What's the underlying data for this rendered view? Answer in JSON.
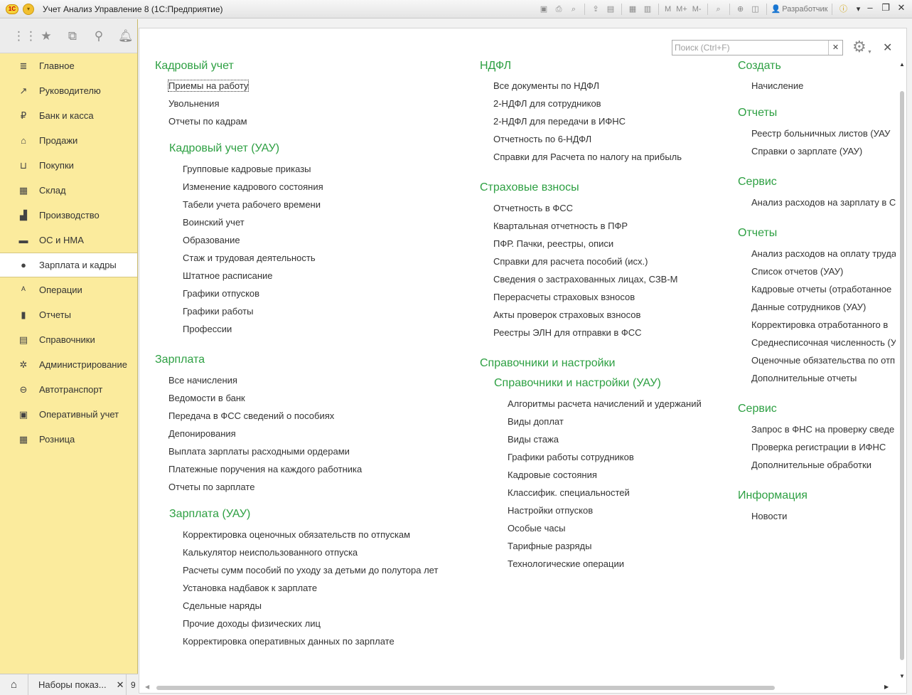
{
  "window": {
    "logo": "1С",
    "title": "Учет Анализ Управление 8  (1С:Предприятие)",
    "toolbar_text": [
      "M",
      "M+",
      "M-"
    ],
    "user": "Разработчик"
  },
  "quickbar": [
    "apps-grid-icon",
    "favorites-star-icon",
    "history-icon",
    "search-icon",
    "bell-icon"
  ],
  "sidebar": {
    "items": [
      {
        "label": "Главное",
        "icon": "≣"
      },
      {
        "label": "Руководителю",
        "icon": "↗"
      },
      {
        "label": "Банк и касса",
        "icon": "₽"
      },
      {
        "label": "Продажи",
        "icon": "⌂"
      },
      {
        "label": "Покупки",
        "icon": "⊔"
      },
      {
        "label": "Склад",
        "icon": "▦"
      },
      {
        "label": "Производство",
        "icon": "▟"
      },
      {
        "label": "ОС и НМА",
        "icon": "▬"
      },
      {
        "label": "Зарплата и кадры",
        "icon": "●"
      },
      {
        "label": "Операции",
        "icon": "ᴬ"
      },
      {
        "label": "Отчеты",
        "icon": "▮"
      },
      {
        "label": "Справочники",
        "icon": "▤"
      },
      {
        "label": "Администрирование",
        "icon": "✲"
      },
      {
        "label": "Автотранспорт",
        "icon": "⊖"
      },
      {
        "label": "Оперативный учет",
        "icon": "▣"
      },
      {
        "label": "Розница",
        "icon": "▦"
      }
    ],
    "active_index": 8
  },
  "bottom": {
    "tab_label": "Наборы показ...",
    "more": "9"
  },
  "search": {
    "placeholder": "Поиск (Ctrl+F)",
    "value": ""
  },
  "col1": {
    "kadry_head": "Кадровый учет",
    "kadry": [
      "Приемы на работу",
      "Увольнения",
      "Отчеты по кадрам"
    ],
    "kadry_uau_head": "Кадровый учет (УАУ)",
    "kadry_uau": [
      "Групповые кадровые приказы",
      "Изменение кадрового состояния",
      "Табели учета рабочего времени",
      "Воинский учет",
      "Образование",
      "Стаж и трудовая деятельность",
      "Штатное расписание",
      "Графики отпусков",
      "Графики работы",
      "Профессии"
    ],
    "zp_head": "Зарплата",
    "zp": [
      "Все начисления",
      "Ведомости в банк",
      "Передача в ФСС сведений о пособиях",
      "Депонирования",
      "Выплата зарплаты расходными ордерами",
      "Платежные поручения на каждого работника",
      "Отчеты по зарплате"
    ],
    "zp_uau_head": "Зарплата (УАУ)",
    "zp_uau": [
      "Корректировка оценочных обязательств по отпускам",
      "Калькулятор неиспользованного отпуска",
      "Расчеты сумм пособий по уходу за детьми до полутора лет",
      "Установка надбавок к зарплате",
      "Сдельные наряды",
      "Прочие доходы физических лиц",
      "Корректировка оперативных данных по зарплате"
    ]
  },
  "col2": {
    "ndfl_head": "НДФЛ",
    "ndfl": [
      "Все документы по НДФЛ",
      "2-НДФЛ для сотрудников",
      "2-НДФЛ для передачи в ИФНС",
      "Отчетность по 6-НДФЛ",
      "Справки для Расчета по налогу на прибыль"
    ],
    "vznosy_head": "Страховые взносы",
    "vznosy": [
      "Отчетность в ФСС",
      "Квартальная отчетность в ПФР",
      "ПФР. Пачки, реестры, описи",
      "Справки для расчета пособий (исх.)",
      "Сведения о застрахованных лицах, СЗВ-М",
      "Перерасчеты страховых взносов",
      "Акты проверок страховых взносов",
      "Реестры ЭЛН для отправки в ФСС"
    ],
    "sprav_head": "Справочники и настройки",
    "sprav_uau_head": "Справочники и настройки (УАУ)",
    "sprav_uau": [
      "Алгоритмы расчета начислений и удержаний",
      "Виды доплат",
      "Виды стажа",
      "Графики работы сотрудников",
      "Кадровые состояния",
      "Классифик. специальностей",
      "Настройки отпусков",
      "Особые часы",
      "Тарифные разряды",
      "Технологические операции"
    ]
  },
  "col3": {
    "create_head": "Создать",
    "create": [
      "Начисление"
    ],
    "reports1_head": "Отчеты",
    "reports1": [
      "Реестр больничных листов (УАУ",
      "Справки о зарплате (УАУ)"
    ],
    "service1_head": "Сервис",
    "service1": [
      "Анализ расходов на зарплату в С"
    ],
    "reports2_head": "Отчеты",
    "reports2": [
      "Анализ расходов на оплату труда",
      "Список отчетов (УАУ)",
      "Кадровые отчеты (отработанное",
      "Данные сотрудников (УАУ)",
      "Корректировка отработанного в",
      "Среднесписочная численность (У",
      "Оценочные обязательства по отп",
      "Дополнительные отчеты"
    ],
    "service2_head": "Сервис",
    "service2": [
      "Запрос в ФНС на проверку сведе",
      "Проверка регистрации в ИФНС",
      "Дополнительные обработки"
    ],
    "info_head": "Информация",
    "info": [
      "Новости"
    ]
  }
}
